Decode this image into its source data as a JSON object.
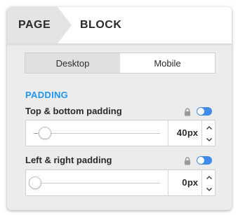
{
  "tabs": {
    "page_label": "PAGE",
    "block_label": "BLOCK"
  },
  "device_toggle": {
    "options": [
      "Desktop",
      "Mobile"
    ],
    "selected": "Desktop"
  },
  "section": {
    "title": "PADDING"
  },
  "fields": [
    {
      "label": "Top & bottom padding",
      "value": "40",
      "unit": "px",
      "slider_level_fraction": 0.1,
      "locked": true,
      "toggle_on": true
    },
    {
      "label": "Left & right padding",
      "value": "0",
      "unit": "px",
      "slider_level_fraction": 0.0,
      "locked": true,
      "toggle_on": true
    }
  ],
  "colors": {
    "accent": "#2196f3",
    "toggle": "#3f8be8",
    "panel_bg": "#ececec"
  },
  "icons": [
    "lock-icon",
    "toggle-switch",
    "chevron-up-icon",
    "chevron-down-icon"
  ]
}
